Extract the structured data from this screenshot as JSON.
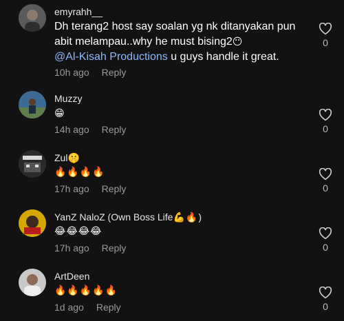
{
  "comments": [
    {
      "username": "emyrahh__",
      "text_line1": "Dh terang2 host say soalan yg nk ditanyakan pun",
      "text_line2": "abit melampau..why he must bising2",
      "text_line2_emoji": "😶",
      "mention": "@Al-Kisah Productions",
      "text_line3": " u guys handle it great.",
      "time": "10h ago",
      "reply_label": "Reply",
      "like_count": "0",
      "avatar_color": "#6b6b6b"
    },
    {
      "username": "Muzzy",
      "emojis": "😁",
      "time": "14h ago",
      "reply_label": "Reply",
      "like_count": "0",
      "avatar_color": "#3a5f8a"
    },
    {
      "username": "Zul",
      "username_emoji": "🤫",
      "emojis": "🔥🔥🔥🔥",
      "time": "17h ago",
      "reply_label": "Reply",
      "like_count": "0",
      "avatar_color": "#2b2b2b"
    },
    {
      "username": "YanZ NaloZ (Own Boss Life",
      "username_emoji": "💪🔥",
      "username_suffix": ")",
      "emojis": "😂😂😂😂",
      "time": "17h ago",
      "reply_label": "Reply",
      "like_count": "0",
      "avatar_color": "#c9a400"
    },
    {
      "username": "ArtDeen",
      "emojis": "🔥🔥🔥🔥🔥",
      "time": "1d ago",
      "reply_label": "Reply",
      "like_count": "0",
      "avatar_color": "#b7b7b7"
    }
  ]
}
